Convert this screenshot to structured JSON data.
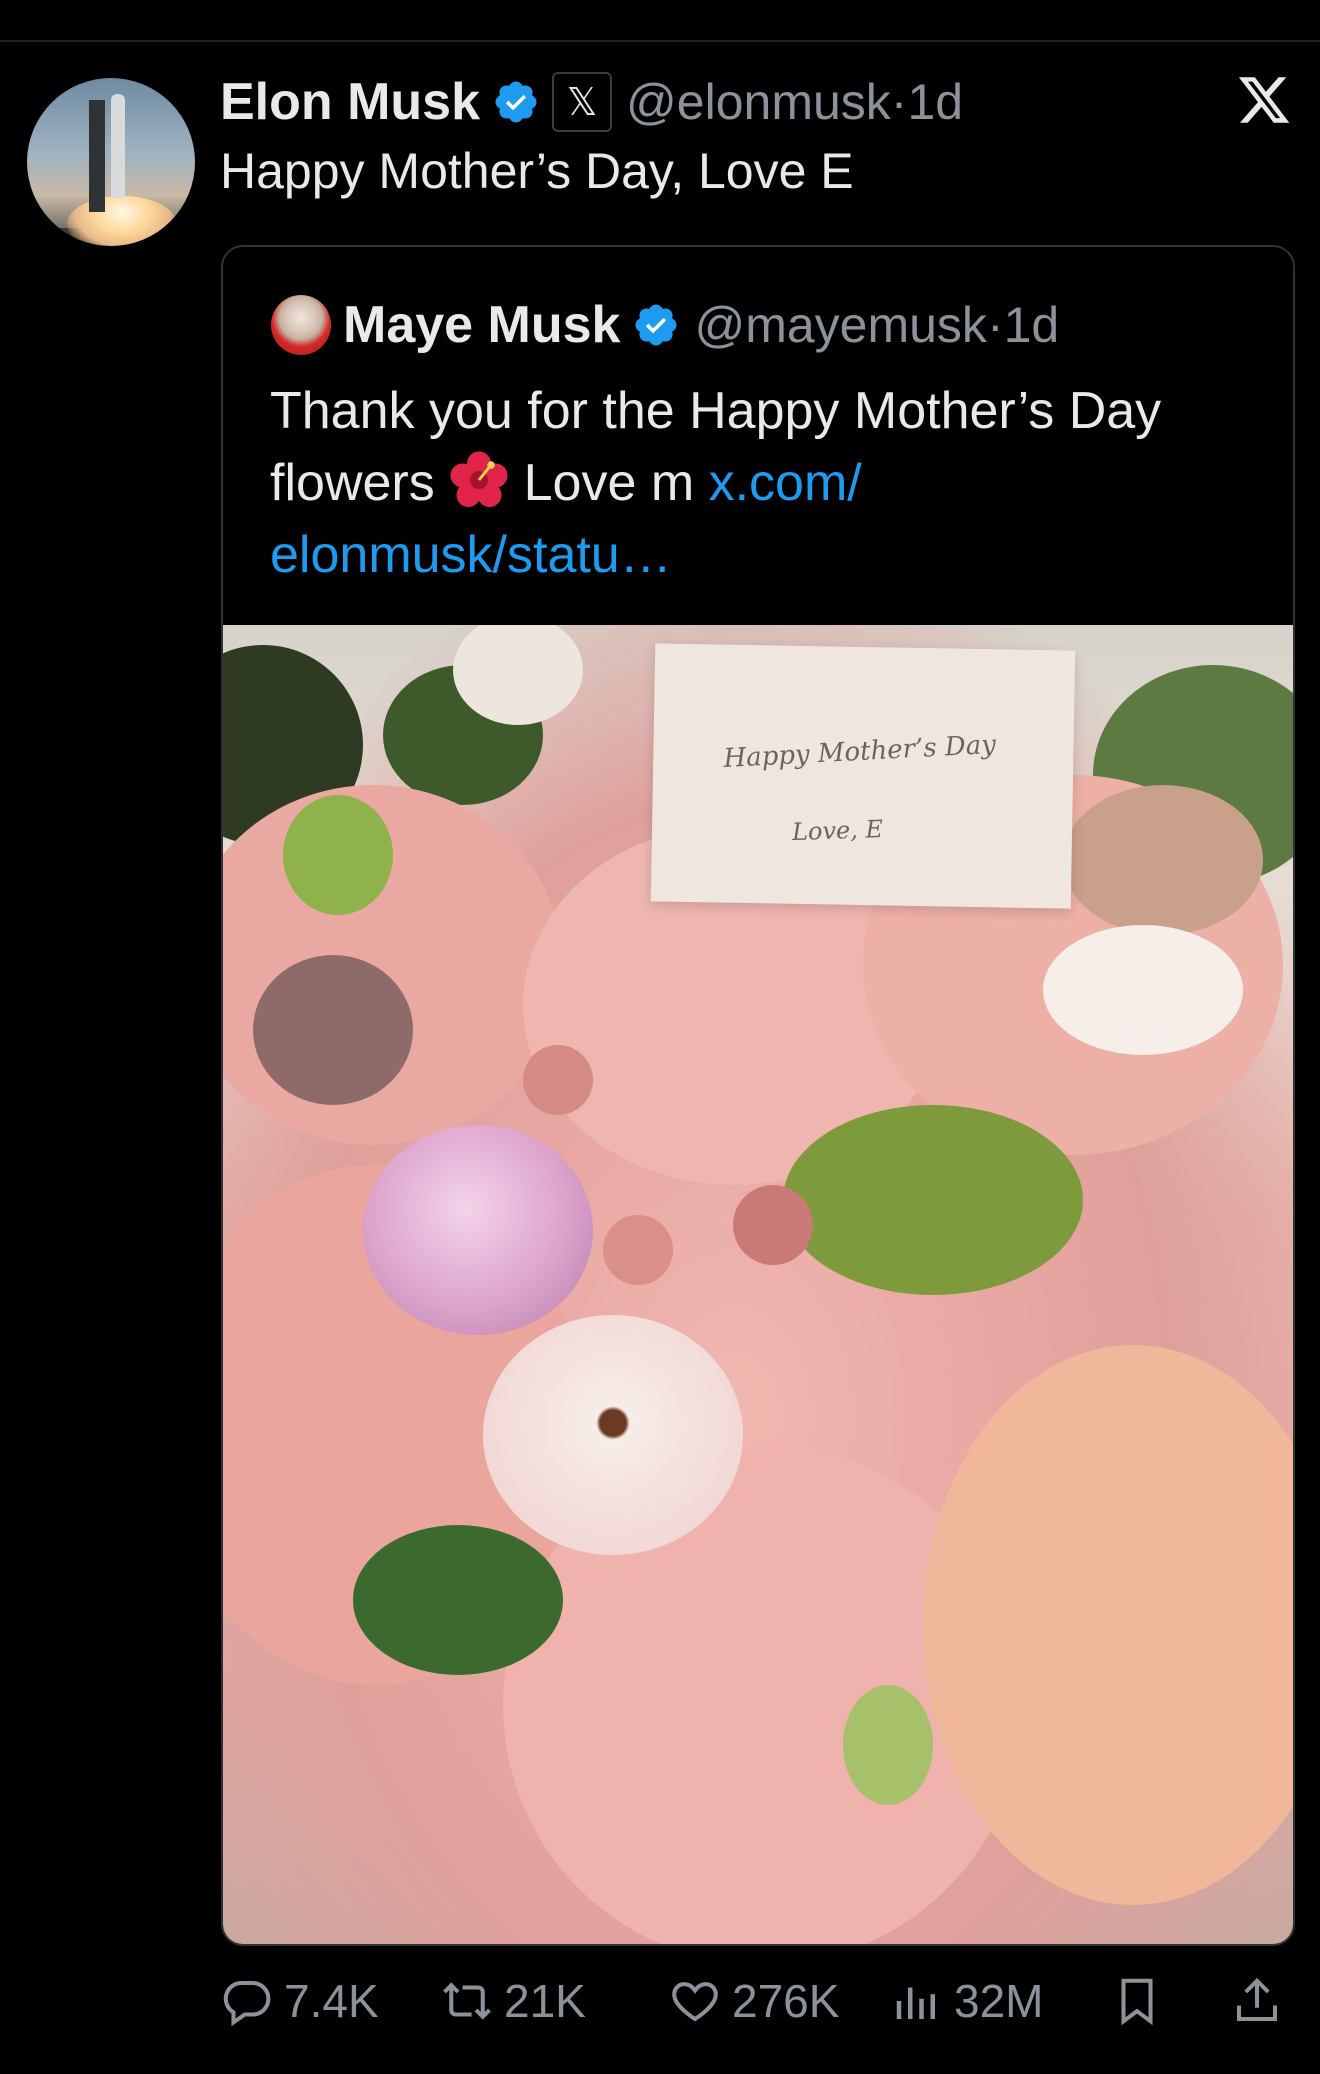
{
  "tweet": {
    "author_name": "Elon Musk",
    "handle": "@elonmusk",
    "separator": "·",
    "time": "1d",
    "text": "Happy Mother’s Day, Love E"
  },
  "quoted": {
    "author_name": "Maye Musk",
    "handle": "@mayemusk",
    "separator": "·",
    "time": "1d",
    "text": "Thank you for the Happy Mother’s Day flowers",
    "text_after_emoji": " Love m ",
    "link": "x.com/ elonmusk/statu…",
    "photo_card": {
      "line1": "Happy Mother’s Day",
      "line2": "Love, E"
    }
  },
  "actions": {
    "replies": "7.4K",
    "reposts": "21K",
    "likes": "276K",
    "views": "32M"
  },
  "icons": [
    "verified-badge-icon",
    "x-affiliate-icon",
    "x-logo-icon",
    "hibiscus-icon",
    "reply-icon",
    "repost-icon",
    "like-icon",
    "views-icon",
    "bookmark-icon",
    "share-icon"
  ],
  "colors": {
    "background": "#000000",
    "text": "#e7e9ea",
    "muted": "#8b9299",
    "link": "#1d9bf0",
    "verified": "#1d9bf0"
  }
}
